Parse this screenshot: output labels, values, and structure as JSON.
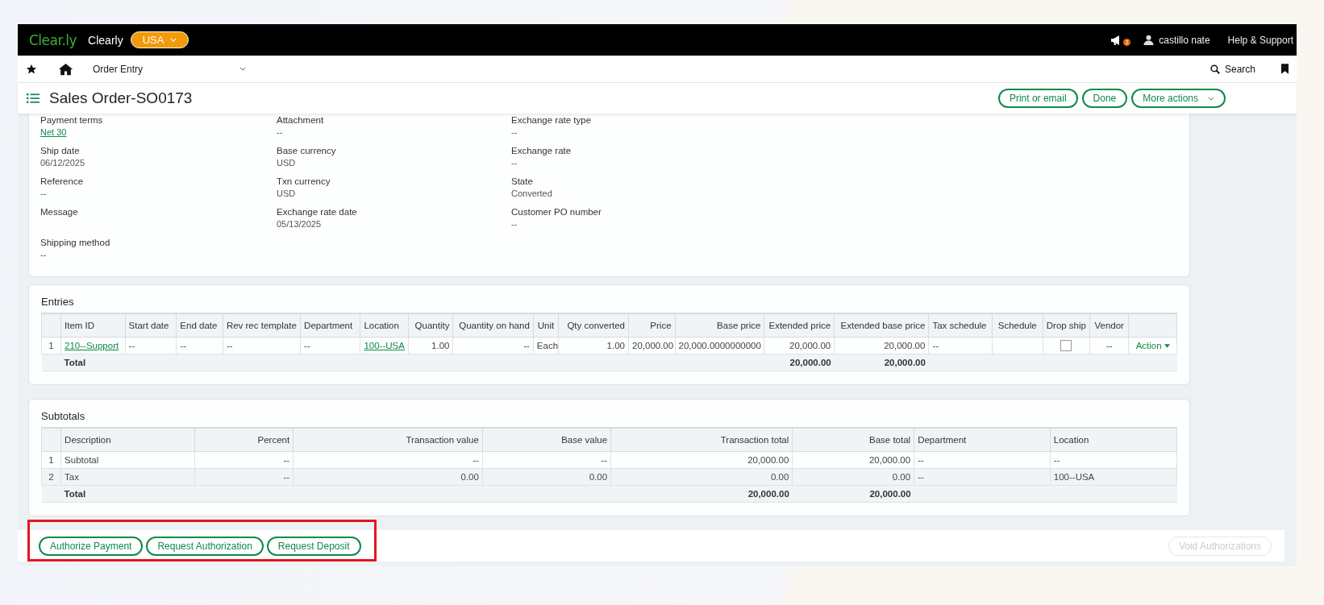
{
  "top_bar": {
    "logo": "Clear.ly",
    "company": "Clearly",
    "entity": "USA",
    "notifications": "2",
    "user": "castillo nate",
    "help": "Help & Support"
  },
  "nav_bar": {
    "module": "Order Entry",
    "search": "Search"
  },
  "title_bar": {
    "title": "Sales Order-SO0173",
    "buttons": [
      {
        "label": "Print or email",
        "dropdown": false
      },
      {
        "label": "Done",
        "dropdown": false
      },
      {
        "label": "More actions",
        "dropdown": true
      }
    ]
  },
  "details": {
    "columns": [
      [
        {
          "label": "Payment terms",
          "value": "Net 30",
          "link": true
        },
        {
          "label": "Ship date",
          "value": "06/12/2025",
          "link": false
        },
        {
          "label": "Reference",
          "value": "--",
          "link": false
        },
        {
          "label": "Message"
        },
        {
          "label": "Shipping method",
          "value": "--",
          "link": false
        }
      ],
      [
        {
          "label": "Attachment",
          "value": "--",
          "link": false
        },
        {
          "label": "Base currency",
          "value": "USD",
          "link": false
        },
        {
          "label": "Txn currency",
          "value": "USD",
          "link": false
        },
        {
          "label": "Exchange rate date",
          "value": "05/13/2025",
          "link": false
        }
      ],
      [
        {
          "label": "Exchange rate type",
          "value": "--",
          "link": false
        },
        {
          "label": "Exchange rate",
          "value": "--",
          "link": false
        },
        {
          "label": "State",
          "value": "Converted",
          "link": false
        },
        {
          "label": "Customer PO number",
          "value": "--",
          "link": false
        }
      ]
    ]
  },
  "entries": {
    "title": "Entries",
    "columns": [
      {
        "label": "Item ID",
        "kind": "text"
      },
      {
        "label": "Start date",
        "kind": "text"
      },
      {
        "label": "End date",
        "kind": "text"
      },
      {
        "label": "Rev rec template",
        "kind": "text"
      },
      {
        "label": "Department",
        "kind": "text"
      },
      {
        "label": "Location",
        "kind": "text"
      },
      {
        "label": "Quantity",
        "kind": "number"
      },
      {
        "label": "Quantity on hand",
        "kind": "number"
      },
      {
        "label": "Unit",
        "kind": "center"
      },
      {
        "label": "Qty converted",
        "kind": "number"
      },
      {
        "label": "Price",
        "kind": "number"
      },
      {
        "label": "Base price",
        "kind": "number"
      },
      {
        "label": "Extended price",
        "kind": "number",
        "total": "20,000.00"
      },
      {
        "label": "Extended base price",
        "kind": "number",
        "total": "20,000.00"
      },
      {
        "label": "Tax schedule",
        "kind": "text"
      },
      {
        "label": "Schedule",
        "kind": "center"
      },
      {
        "label": "Drop ship",
        "kind": "center"
      },
      {
        "label": "Vendor",
        "kind": "center"
      },
      {
        "kind": "menu"
      }
    ],
    "rows": [
      {
        "number": "1",
        "cells": [
          {
            "kind": "link",
            "text": "210--Support"
          },
          {
            "kind": "text",
            "text": "--"
          },
          {
            "kind": "text",
            "text": "--"
          },
          {
            "kind": "text",
            "text": "--"
          },
          {
            "kind": "text",
            "text": "--"
          },
          {
            "kind": "link",
            "text": "100--USA"
          },
          {
            "kind": "text",
            "text": "1.00"
          },
          {
            "kind": "text",
            "text": "--"
          },
          {
            "kind": "text",
            "text": "Each"
          },
          {
            "kind": "text",
            "text": "1.00"
          },
          {
            "kind": "text",
            "text": "20,000.00"
          },
          {
            "kind": "text",
            "text": "20,000.0000000000"
          },
          {
            "kind": "text",
            "text": "20,000.00"
          },
          {
            "kind": "text",
            "text": "20,000.00"
          },
          {
            "kind": "text",
            "text": "--"
          },
          {
            "kind": "empty"
          },
          {
            "kind": "checkbox",
            "checked": false
          },
          {
            "kind": "text",
            "text": "--"
          },
          {
            "kind": "menu",
            "text": "Action"
          }
        ]
      }
    ],
    "total_label": "Total"
  },
  "subtotals": {
    "title": "Subtotals",
    "columns": [
      {
        "label": "Description",
        "kind": "text"
      },
      {
        "label": "Percent",
        "kind": "number"
      },
      {
        "label": "Transaction value",
        "kind": "number"
      },
      {
        "label": "Base value",
        "kind": "number"
      },
      {
        "label": "Transaction total",
        "kind": "number",
        "total": "20,000.00"
      },
      {
        "label": "Base total",
        "kind": "number",
        "total": "20,000.00"
      },
      {
        "label": "Department",
        "kind": "text"
      },
      {
        "label": "Location",
        "kind": "text"
      }
    ],
    "rows": [
      {
        "number": "1",
        "cells": [
          {
            "kind": "text",
            "text": "Subtotal"
          },
          {
            "kind": "text",
            "text": "--"
          },
          {
            "kind": "text",
            "text": "--"
          },
          {
            "kind": "text",
            "text": "--"
          },
          {
            "kind": "text",
            "text": "20,000.00"
          },
          {
            "kind": "text",
            "text": "20,000.00"
          },
          {
            "kind": "text",
            "text": "--"
          },
          {
            "kind": "text",
            "text": "--"
          }
        ]
      },
      {
        "number": "2",
        "cells": [
          {
            "kind": "text",
            "text": "Tax"
          },
          {
            "kind": "text",
            "text": "--"
          },
          {
            "kind": "text",
            "text": "0.00"
          },
          {
            "kind": "text",
            "text": "0.00"
          },
          {
            "kind": "text",
            "text": "0.00"
          },
          {
            "kind": "text",
            "text": "0.00"
          },
          {
            "kind": "text",
            "text": "--"
          },
          {
            "kind": "text",
            "text": "100--USA"
          }
        ]
      }
    ],
    "total_label": "Total"
  },
  "footer": {
    "highlighted": true,
    "buttons": [
      {
        "label": "Authorize Payment",
        "disabled": false
      },
      {
        "label": "Request Authorization",
        "disabled": false
      },
      {
        "label": "Request Deposit",
        "disabled": false
      },
      {
        "label": "Void Authorizations",
        "disabled": true
      }
    ]
  }
}
